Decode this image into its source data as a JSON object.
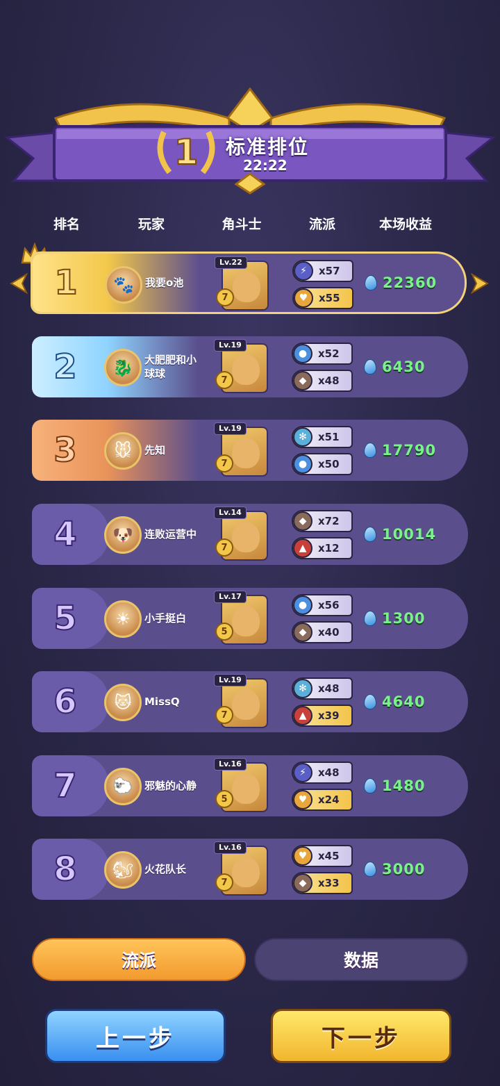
{
  "banner": {
    "rank": "1",
    "title": "标准排位",
    "time": "22:22"
  },
  "header": {
    "rank": "排名",
    "player": "玩家",
    "fighter": "角斗士",
    "faction": "流派",
    "income": "本场收益"
  },
  "rows": [
    {
      "rank": "1",
      "name": "我要o池",
      "level": "Lv.22",
      "stars": "7",
      "traits": [
        {
          "icon": "bolt-icon",
          "count": "x57",
          "color": "#5a5fc8",
          "style": "lilac"
        },
        {
          "icon": "heart-icon",
          "count": "x55",
          "color": "#e9a63a",
          "style": "gold"
        }
      ],
      "income": "22360"
    },
    {
      "rank": "2",
      "name": "大肥肥和小球球",
      "level": "Lv.19",
      "stars": "7",
      "traits": [
        {
          "icon": "water-drop-icon",
          "count": "x52",
          "color": "#4a8fe0",
          "style": "lilac"
        },
        {
          "icon": "shield-icon",
          "count": "x48",
          "color": "#8a6a5a",
          "style": "lilac"
        }
      ],
      "income": "6430"
    },
    {
      "rank": "3",
      "name": "先知",
      "level": "Lv.19",
      "stars": "7",
      "traits": [
        {
          "icon": "snowflake-icon",
          "count": "x51",
          "color": "#5ab0d8",
          "style": "lilac"
        },
        {
          "icon": "water-drop-icon",
          "count": "x50",
          "color": "#4a8fe0",
          "style": "lilac"
        }
      ],
      "income": "17790"
    },
    {
      "rank": "4",
      "name": "连败运营中",
      "level": "Lv.14",
      "stars": "7",
      "traits": [
        {
          "icon": "shield-icon",
          "count": "x72",
          "color": "#8a6a5a",
          "style": "lilac"
        },
        {
          "icon": "flame-icon",
          "count": "x12",
          "color": "#c8403a",
          "style": "lilac"
        }
      ],
      "income": "10014"
    },
    {
      "rank": "5",
      "name": "小手挺白",
      "level": "Lv.17",
      "stars": "5",
      "traits": [
        {
          "icon": "water-drop-icon",
          "count": "x56",
          "color": "#4a8fe0",
          "style": "lilac"
        },
        {
          "icon": "shield-icon",
          "count": "x40",
          "color": "#8a6a5a",
          "style": "lilac"
        }
      ],
      "income": "1300"
    },
    {
      "rank": "6",
      "name": "MissQ",
      "level": "Lv.19",
      "stars": "7",
      "traits": [
        {
          "icon": "snowflake-icon",
          "count": "x48",
          "color": "#5ab0d8",
          "style": "lilac"
        },
        {
          "icon": "flame-icon",
          "count": "x39",
          "color": "#c8403a",
          "style": "gold"
        }
      ],
      "income": "4640"
    },
    {
      "rank": "7",
      "name": "邪魅的心静",
      "level": "Lv.16",
      "stars": "5",
      "traits": [
        {
          "icon": "bolt-icon",
          "count": "x48",
          "color": "#5a5fc8",
          "style": "lilac"
        },
        {
          "icon": "heart-icon",
          "count": "x24",
          "color": "#e9a63a",
          "style": "gold"
        }
      ],
      "income": "1480"
    },
    {
      "rank": "8",
      "name": "火花队长",
      "level": "Lv.16",
      "stars": "7",
      "traits": [
        {
          "icon": "heart-icon",
          "count": "x45",
          "color": "#e9a63a",
          "style": "lilac"
        },
        {
          "icon": "shield-icon",
          "count": "x33",
          "color": "#8a6a5a",
          "style": "gold"
        }
      ],
      "income": "3000"
    }
  ],
  "tabs": {
    "faction": "流派",
    "stats": "数据"
  },
  "buttons": {
    "prev": "上一步",
    "next": "下一步"
  },
  "colors": {
    "income_green": "#7af28a",
    "rank1_gold": "#f3c84a",
    "rank2_blue": "#8fd4ff",
    "rank3_orange": "#e9935a",
    "row_purple": "#5a4e8c"
  }
}
